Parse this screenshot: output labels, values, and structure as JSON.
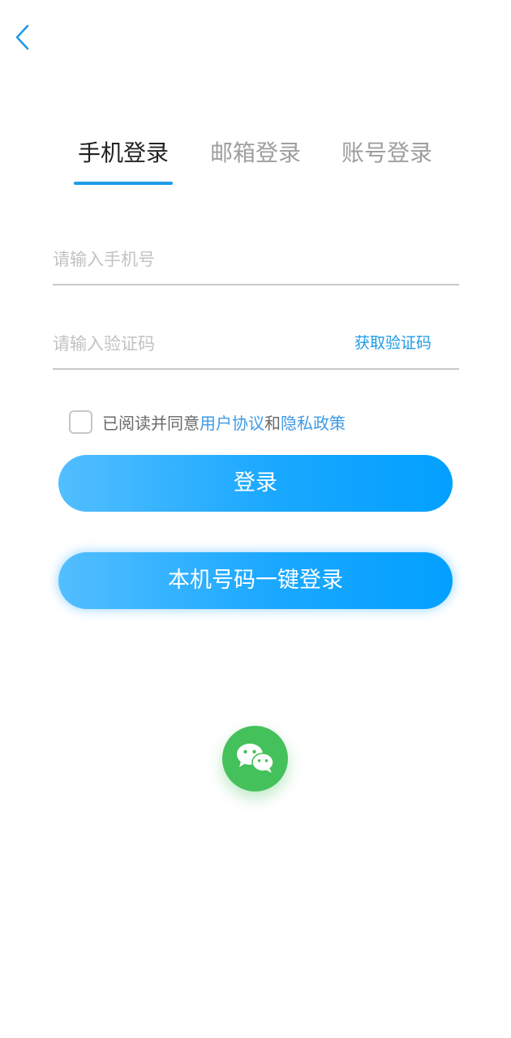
{
  "nav": {
    "back_icon": "chevron-left-icon"
  },
  "tabs": [
    {
      "label": "手机登录",
      "active": true
    },
    {
      "label": "邮箱登录",
      "active": false
    },
    {
      "label": "账号登录",
      "active": false
    }
  ],
  "form": {
    "phone_placeholder": "请输入手机号",
    "phone_value": "",
    "code_placeholder": "请输入验证码",
    "code_value": "",
    "get_code_label": "获取验证码"
  },
  "agreement": {
    "checked": false,
    "prefix": "已阅读并同意",
    "user_agreement": "用户协议",
    "conjunction": "和",
    "privacy_policy": "隐私政策"
  },
  "buttons": {
    "login_label": "登录",
    "onekey_label": "本机号码一键登录"
  },
  "social": {
    "wechat_icon": "wechat-icon"
  },
  "colors": {
    "accent": "#1e9be8",
    "button_gradient_start": "#52beff",
    "button_gradient_end": "#03a0ff",
    "wechat_green": "#45c15b"
  }
}
